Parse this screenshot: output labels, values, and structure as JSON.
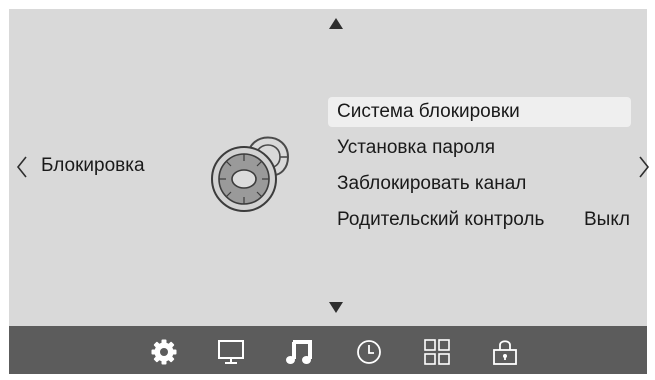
{
  "nav": {
    "up_arrow": "arrow-up-icon",
    "down_arrow": "arrow-down-icon",
    "prev": "chevron-left-icon",
    "next": "chevron-right-icon"
  },
  "category": {
    "label": "Блокировка",
    "icon": "padlock-icon"
  },
  "menu": {
    "items": [
      {
        "label": "Система блокировки",
        "selected": true
      },
      {
        "label": "Установка пароля"
      },
      {
        "label": "Заблокировать канал"
      },
      {
        "label": "Родительский контроль",
        "value": "Выкл"
      }
    ]
  },
  "bottom_bar": {
    "icons": [
      "settings-gear-icon",
      "monitor-icon",
      "music-note-icon",
      "clock-icon",
      "grid-icon",
      "lock-icon"
    ],
    "active": "lock-icon"
  },
  "colors": {
    "screen_bg": "#d9d9d9",
    "bar_bg": "#5c5c5c",
    "selected_bg": "#efefef",
    "text": "#1a1a1a"
  }
}
